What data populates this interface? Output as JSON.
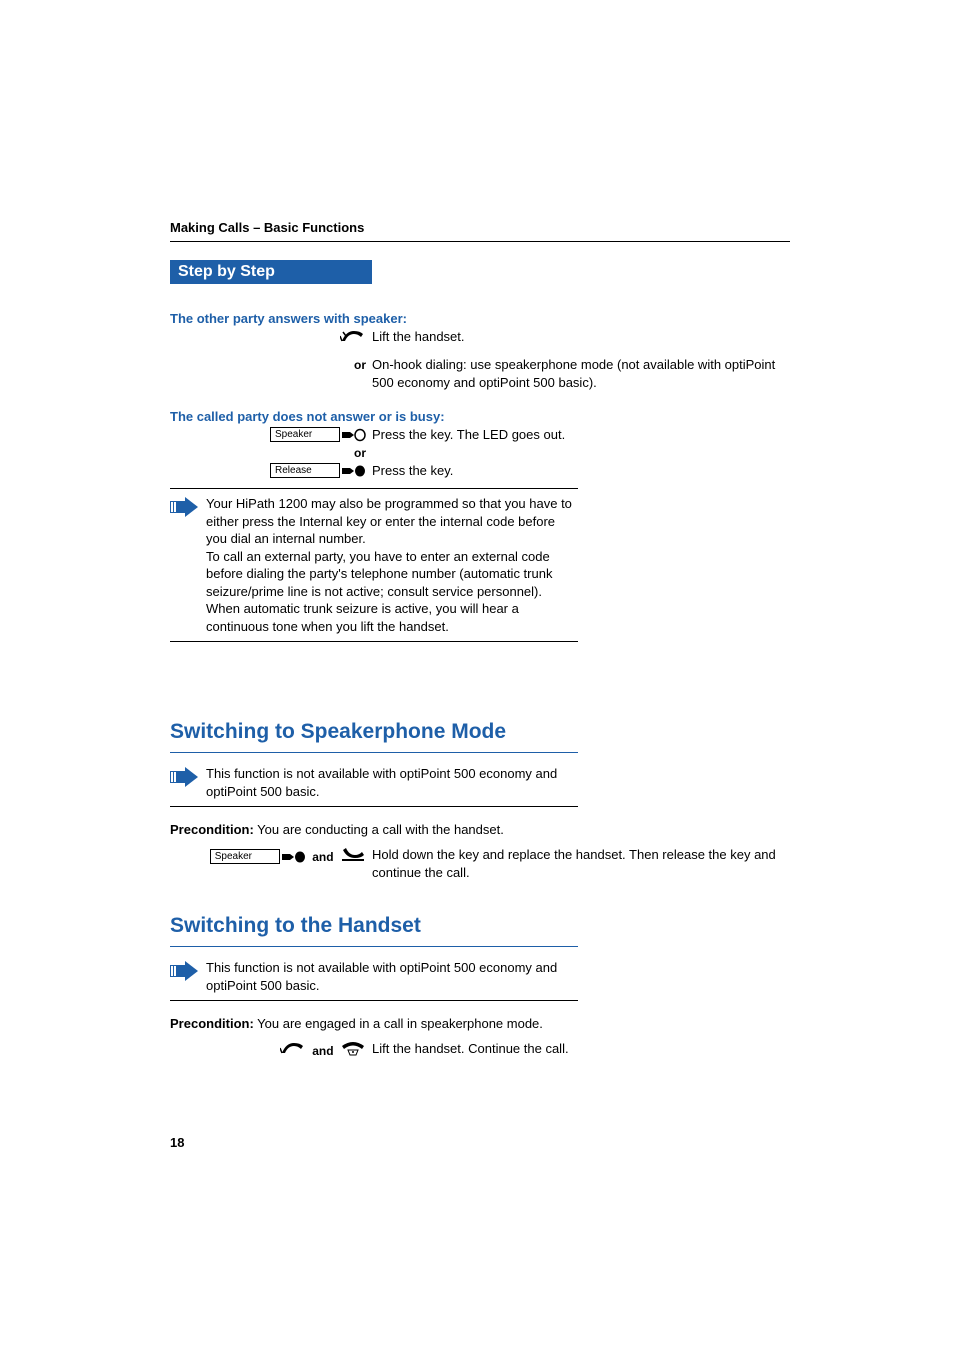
{
  "header": {
    "breadcrumb": "Making Calls – Basic Functions"
  },
  "stepBanner": "Step by Step",
  "rows": {
    "answerSpeaker": "The other party answers with speaker:",
    "liftHandset": "Lift the handset.",
    "orLabel": "or",
    "onHook": "On-hook dialing: use speakerphone mode (not available with optiPoint 500 economy and optiPoint 500 basic).",
    "noAnswer": "The called party does not answer or is busy:",
    "speakerKey": "Speaker",
    "pressKeyLed": "Press the key. The LED goes out.",
    "orLabel2": "or",
    "releaseKey": "Release",
    "pressKey": "Press the key."
  },
  "note1": {
    "p1": "Your HiPath 1200 may also be programmed so that you have to either press the Internal key or enter the internal code before you dial an internal number.",
    "p2": "To call an external party, you have to enter an external code before dialing the party's telephone number (automatic trunk seizure/prime line is not active; consult service personnel).",
    "p3": "When automatic trunk seizure is active, you will hear a continuous tone when you lift the handset."
  },
  "section1": {
    "heading": "Switching to Speakerphone Mode",
    "note": "This function is not available with optiPoint 500 economy and optiPoint 500 basic.",
    "precondLabel": "Precondition:",
    "precond": " You are conducting a call with the handset.",
    "speakerKey": "Speaker",
    "andLabel": "and",
    "action": "Hold down the key and replace the handset. Then release the key and continue the call."
  },
  "section2": {
    "heading": "Switching to the Handset",
    "note": "This function is not available with optiPoint 500 economy and optiPoint 500 basic.",
    "precondLabel": "Precondition:",
    "precond": " You are engaged in a call in speakerphone mode.",
    "andLabel": "and",
    "action": "Lift the handset. Continue the call."
  },
  "pageNumber": "18"
}
